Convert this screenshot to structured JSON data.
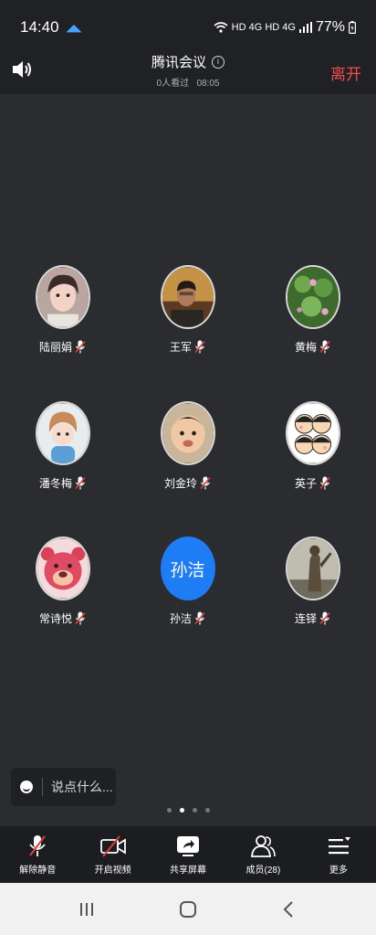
{
  "status_bar": {
    "time": "14:40",
    "network": "HD 4G HD 4G",
    "battery": "77%"
  },
  "header": {
    "title": "腾讯会议",
    "viewers": "0人看过",
    "duration": "08:05",
    "leave_label": "离开"
  },
  "members": [
    {
      "name": "陆丽娟",
      "avatar": "photo-girl",
      "muted": true
    },
    {
      "name": "王军",
      "avatar": "photo-man",
      "muted": true
    },
    {
      "name": "黄梅",
      "avatar": "photo-flowers",
      "muted": true
    },
    {
      "name": "潘冬梅",
      "avatar": "cartoon-girl",
      "muted": true
    },
    {
      "name": "刘金玲",
      "avatar": "photo-baby",
      "muted": true
    },
    {
      "name": "英子",
      "avatar": "cartoon-family",
      "muted": true
    },
    {
      "name": "常诗悦",
      "avatar": "cartoon-bear",
      "muted": true
    },
    {
      "name": "孙洁",
      "avatar_text": "孙洁",
      "muted": true
    },
    {
      "name": "连铎",
      "avatar": "photo-statue",
      "muted": true
    }
  ],
  "chat": {
    "placeholder": "说点什么..."
  },
  "pager": {
    "pages": 4,
    "active": 2
  },
  "toolbar": {
    "unmute": "解除静音",
    "video": "开启视频",
    "share": "共享屏幕",
    "members": "成员(28)",
    "more": "更多"
  },
  "colors": {
    "accent_blue": "#1e7cf4",
    "leave_red": "#ee4b4b",
    "mic_muted_red": "#e23b3b"
  }
}
